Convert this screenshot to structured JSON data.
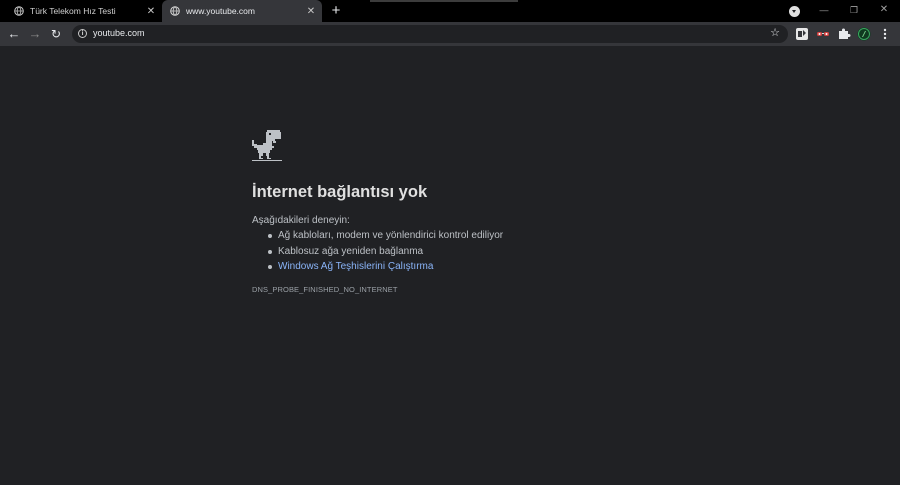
{
  "tabs": [
    {
      "title": "Türk Telekom Hız Testi",
      "close_label": "✕"
    },
    {
      "title": "www.youtube.com",
      "close_label": "✕"
    }
  ],
  "new_tab_label": "+",
  "window_controls": {
    "minimize": "—",
    "maximize": "❐",
    "close": "✕"
  },
  "toolbar": {
    "back_icon": "←",
    "forward_icon": "→",
    "reload_icon": "↻",
    "info_icon": "i",
    "url": "youtube.com",
    "bookmark_icon": "☆"
  },
  "error": {
    "heading": "İnternet bağlantısı yok",
    "suggestions_intro": "Aşağıdakileri deneyin:",
    "suggestions": [
      "Ağ kabloları, modem ve yönlendirici kontrol ediliyor",
      "Kablosuz ağa yeniden bağlanma",
      "Windows Ağ Teşhislerini Çalıştırma"
    ],
    "code": "DNS_PROBE_FINISHED_NO_INTERNET"
  },
  "colors": {
    "page_bg": "#202124",
    "toolbar_bg": "#35363a",
    "tabstrip_bg": "#000000",
    "link": "#8ab4f8"
  }
}
